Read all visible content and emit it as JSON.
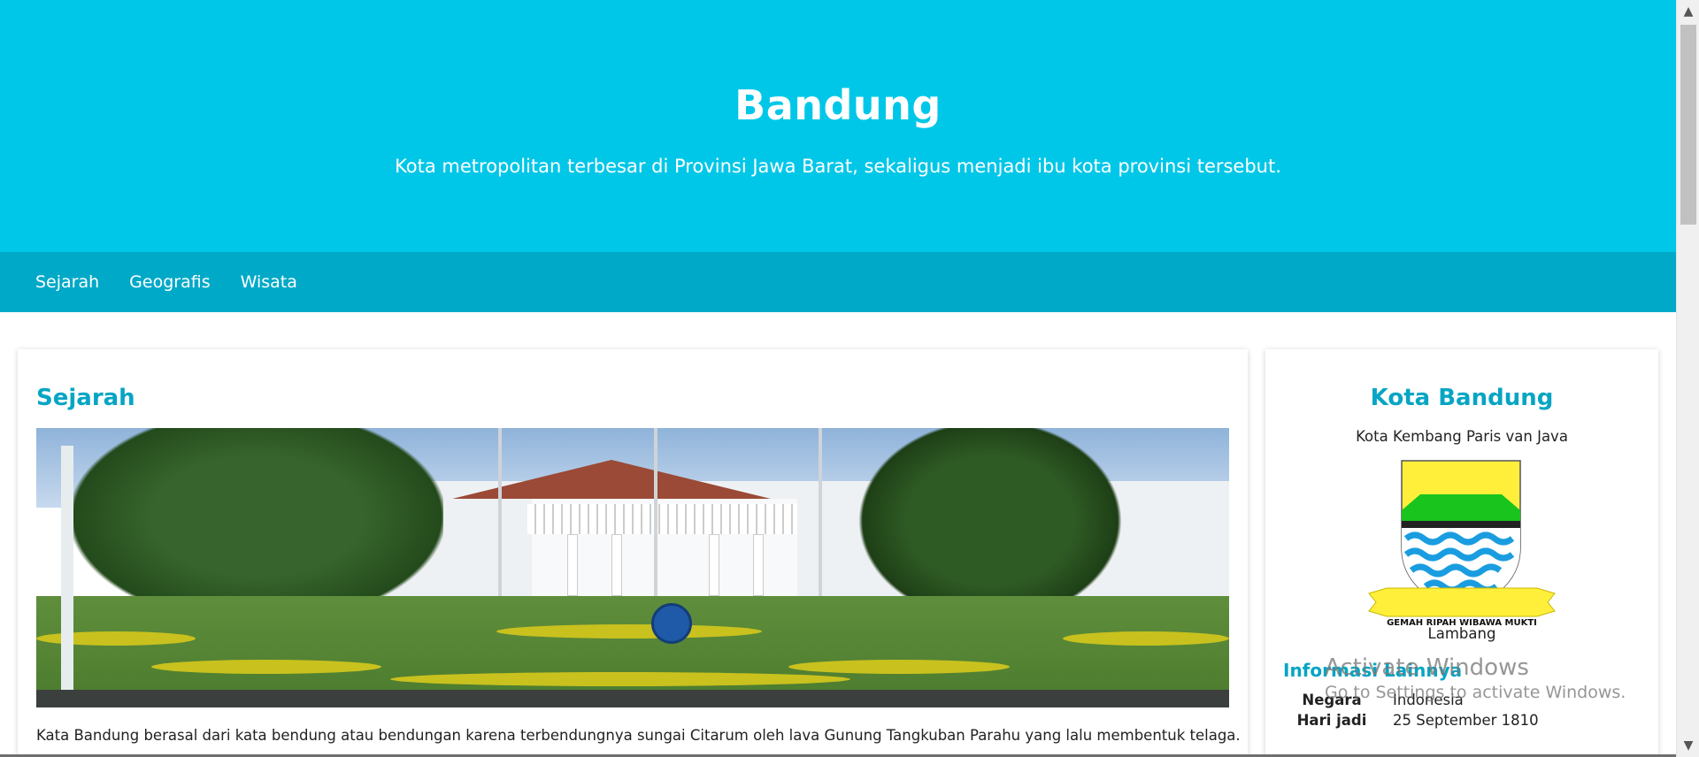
{
  "hero": {
    "title": "Bandung",
    "subtitle": "Kota metropolitan terbesar di Provinsi Jawa Barat, sekaligus menjadi ibu kota provinsi tersebut."
  },
  "nav": {
    "items": [
      {
        "label": "Sejarah"
      },
      {
        "label": "Geografis"
      },
      {
        "label": "Wisata"
      }
    ]
  },
  "main": {
    "heading": "Sejarah",
    "image_alt": "Gedung Sate / Pendopo Bandung",
    "paragraph": "Kata Bandung berasal dari kata bendung atau bendungan karena terbendungnya sungai Citarum oleh lava Gunung Tangkuban Parahu yang lalu membentuk telaga."
  },
  "sidebar": {
    "title": "Kota Bandung",
    "motto": "Kota Kembang Paris van Java",
    "crest_banner": "GEMAH RIPAH WIBAWA MUKTI",
    "crest_caption": "Lambang",
    "info_title": "Informasi Lainnya",
    "rows": [
      {
        "key": "Negara",
        "value": "Indonesia"
      },
      {
        "key": "Hari jadi",
        "value": "25 September 1810"
      }
    ]
  },
  "watermark": {
    "line1": "Activate Windows",
    "line2": "Go to Settings to activate Windows."
  },
  "colors": {
    "hero_bg": "#00c7e8",
    "nav_bg": "#01a9c8",
    "accent_text": "#06a5c4"
  },
  "icons": {
    "scroll_up": "chevron-up-icon",
    "scroll_down": "chevron-down-icon"
  }
}
